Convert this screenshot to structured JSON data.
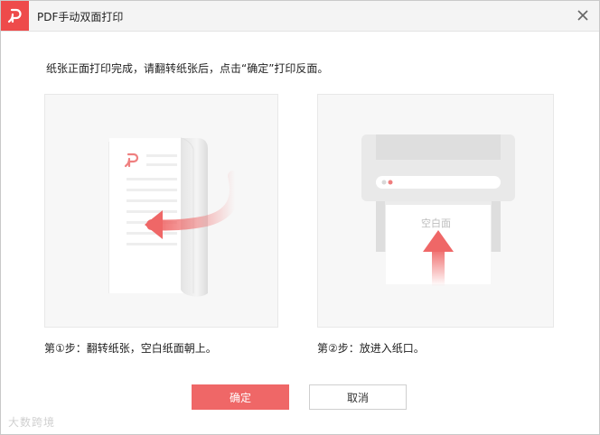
{
  "dialog": {
    "title": "PDF手动双面打印",
    "instruction": "纸张正面打印完成，请翻转纸张后，点击“确定”打印反面。"
  },
  "steps": [
    {
      "caption": "第①步：翻转纸张，空白纸面朝上。"
    },
    {
      "caption": "第②步：放进入纸口。",
      "paper_label": "空白面"
    }
  ],
  "buttons": {
    "ok_label": "确定",
    "cancel_label": "取消"
  },
  "watermark": "大数跨境",
  "colors": {
    "accent": "#ef6767",
    "logo_bg": "#ee4b4b"
  },
  "icons": {
    "app_logo": "pdf-logo-icon",
    "close": "close-icon"
  }
}
